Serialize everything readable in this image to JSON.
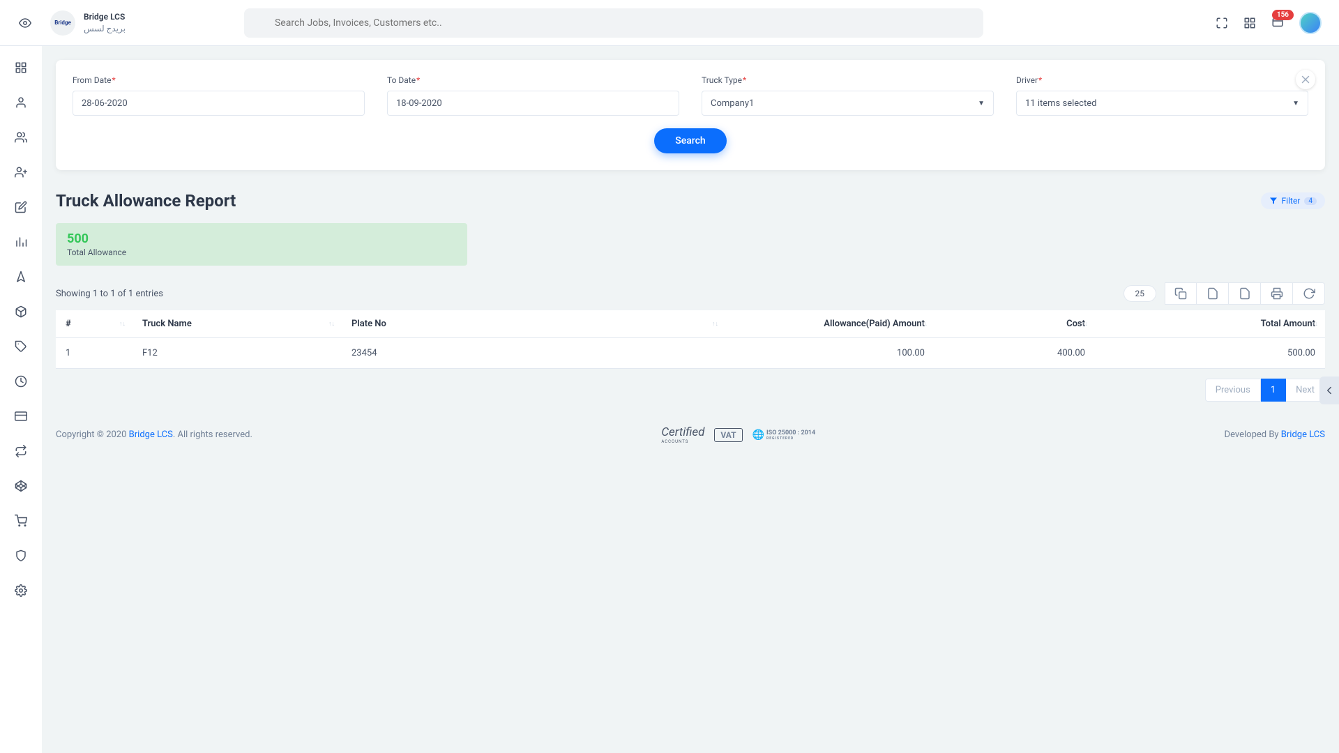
{
  "header": {
    "brand_name": "Bridge LCS",
    "brand_sub": "بريدج لسس",
    "search_placeholder": "Search Jobs, Invoices, Customers etc..",
    "notification_count": "156"
  },
  "filters": {
    "from_date_label": "From Date",
    "from_date_value": "28-06-2020",
    "to_date_label": "To Date",
    "to_date_value": "18-09-2020",
    "truck_type_label": "Truck Type",
    "truck_type_value": "Company1",
    "driver_label": "Driver",
    "driver_value": "11 items selected",
    "search_button": "Search"
  },
  "page": {
    "title": "Truck Allowance Report",
    "filter_pill_label": "Filter",
    "filter_pill_count": "4"
  },
  "summary": {
    "value": "500",
    "label": "Total Allowance"
  },
  "table_meta": {
    "showing": "Showing 1 to 1 of 1 entries",
    "page_size": "25"
  },
  "columns": {
    "c0": "#",
    "c1": "Truck Name",
    "c2": "Plate No",
    "c3": "Allowance(Paid) Amount",
    "c4": "Cost",
    "c5": "Total Amount"
  },
  "row": {
    "idx": "1",
    "truck_name": "F12",
    "plate_no": "23454",
    "allowance": "100.00",
    "cost": "400.00",
    "total": "500.00"
  },
  "pagination": {
    "prev": "Previous",
    "page": "1",
    "next": "Next"
  },
  "footer": {
    "copyright_pre": "Copyright © 2020 ",
    "brand": "Bridge LCS",
    "copyright_post": ". All rights reserved.",
    "certified": "Certified",
    "certified_sub": "ACCOUNTS",
    "vat": "VAT",
    "iso": "25000 : 2014",
    "iso_sub": "REGISTERED",
    "dev_pre": "Developed By ",
    "dev_brand": "Bridge LCS"
  }
}
